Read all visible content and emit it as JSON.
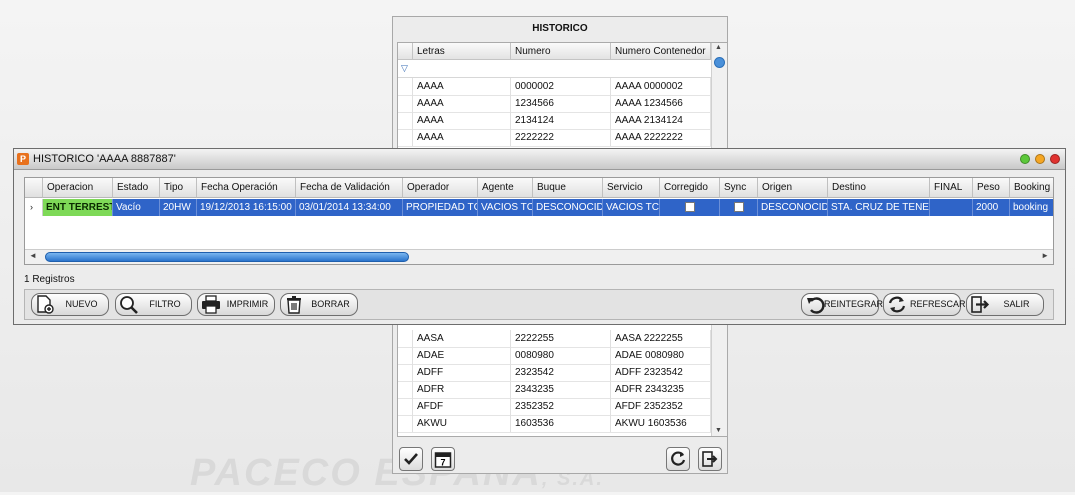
{
  "background_logo": {
    "text": "PACECO ESPAÑA",
    "suffix": ", S.A."
  },
  "back_window": {
    "title": "HISTORICO",
    "columns": [
      "Letras",
      "Numero",
      "Numero Contenedor"
    ],
    "rows_top": [
      [
        "AAAA",
        "0000002",
        "AAAA 0000002"
      ],
      [
        "AAAA",
        "1234566",
        "AAAA 1234566"
      ],
      [
        "AAAA",
        "2134124",
        "AAAA 2134124"
      ],
      [
        "AAAA",
        "2222222",
        "AAAA 2222222"
      ]
    ],
    "rows_bottom": [
      [
        "AASA",
        "2222255",
        "AASA 2222255"
      ],
      [
        "ADAE",
        "0080980",
        "ADAE 0080980"
      ],
      [
        "ADFF",
        "2323542",
        "ADFF 2323542"
      ],
      [
        "ADFR",
        "2343235",
        "ADFR 2343235"
      ],
      [
        "AFDF",
        "2352352",
        "AFDF 2352352"
      ],
      [
        "AKWU",
        "1603536",
        "AKWU 1603536"
      ]
    ],
    "buttons": {
      "accept": "accept-icon",
      "calendar": "calendar-icon",
      "calendar_day": "7",
      "refresh": "refresh-icon",
      "exit": "exit-icon"
    }
  },
  "front_window": {
    "title": "HISTORICO  'AAAA 8887887'",
    "columns": [
      "Operacion",
      "Estado",
      "Tipo",
      "Fecha Operación",
      "Fecha de Validación",
      "Operador",
      "Agente",
      "Buque",
      "Servicio",
      "Corregido",
      "Sync",
      "Origen",
      "Destino",
      "FINAL",
      "Peso",
      "Booking"
    ],
    "row": {
      "operacion": "ENT TERRESTRE",
      "estado": "Vacío",
      "tipo": "20HW",
      "fecha_operacion": "19/12/2013 16:15:00",
      "fecha_validacion": "03/01/2014 13:34:00",
      "operador": "PROPIEDAD TCT",
      "agente": "VACIOS TCT",
      "buque": "DESCONOCIDO",
      "servicio": "VACIOS TCT",
      "corregido": false,
      "sync": false,
      "origen": "DESCONOCIDO",
      "destino": "STA. CRUZ DE TENERIFE",
      "final": "",
      "peso": "2000",
      "booking": "booking"
    },
    "record_count": "1 Registros",
    "buttons": {
      "nuevo": "NUEVO",
      "filtro": "FILTRO",
      "imprimir": "IMPRIMIR",
      "borrar": "BORRAR",
      "reintegrar": "REINTEGRAR",
      "refrescar": "REFRESCAR",
      "salir": "SALIR"
    }
  },
  "colors": {
    "selection": "#2f64c8",
    "operation_cell": "#7ed957",
    "close": "#e0322f",
    "minimize": "#f5a623",
    "maximize": "#5cc83a"
  }
}
